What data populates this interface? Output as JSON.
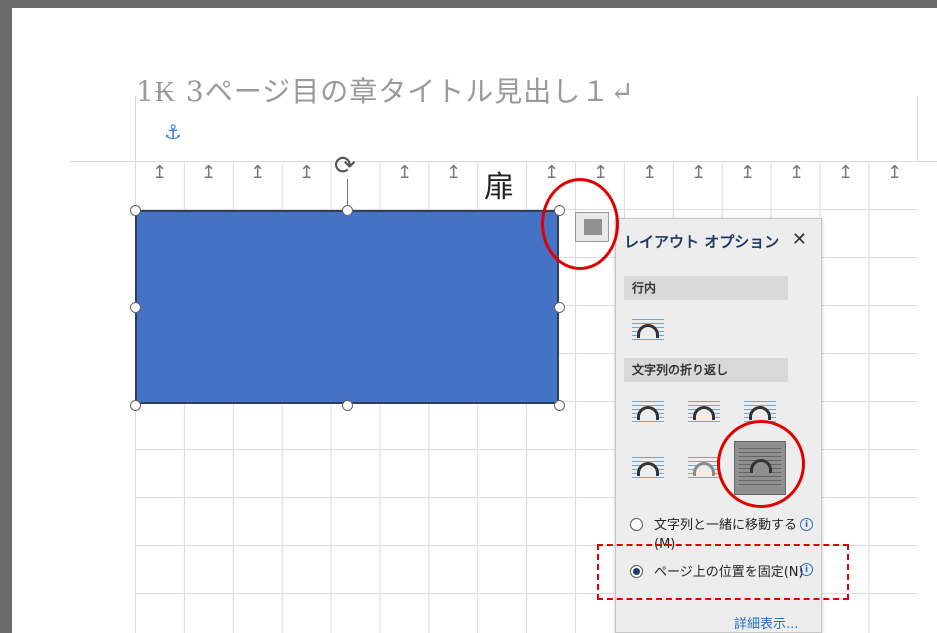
{
  "document": {
    "heading": "1₭ 3ページ目の章タイトル見出し１↵",
    "anchor_icon": "anchor-icon",
    "paragraph_mark": "↵",
    "door_char": "扉"
  },
  "shape": {
    "fill_color": "#4472c4",
    "border_color": "#2f3f5f"
  },
  "layout_options": {
    "title": "レイアウト オプション",
    "close_label": "✕",
    "section_inline": "行内",
    "section_wrap": "文字列の折り返し",
    "radio_move": "文字列と一緒に移動する(M)",
    "radio_fix": "ページ上の位置を固定(N)",
    "info_symbol": "i",
    "detail_link": "詳細表示..."
  },
  "annotation_color": "#e00000"
}
